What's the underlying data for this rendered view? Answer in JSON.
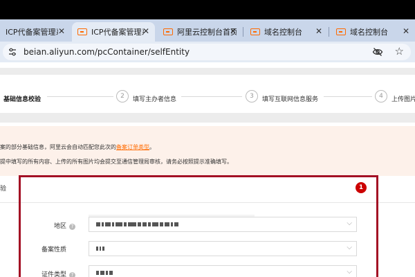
{
  "browser": {
    "tabs": [
      {
        "label": "ICP代备案管理系统",
        "active": false
      },
      {
        "label": "ICP代备案管理系统",
        "active": true
      },
      {
        "label": "阿里云控制台首页",
        "active": false
      },
      {
        "label": "域名控制台",
        "active": false
      },
      {
        "label": "域名控制台",
        "active": false
      }
    ],
    "tab_close": "✕",
    "url": "beian.aliyun.com/pcContainer/selfEntity",
    "star": "☆"
  },
  "steps": [
    {
      "num": "",
      "label": "基础信息校验"
    },
    {
      "num": "2",
      "label": "填写主办者信息"
    },
    {
      "num": "3",
      "label": "填写互联网信息服务"
    },
    {
      "num": "4",
      "label": "上传图片"
    }
  ],
  "notice": {
    "line1_prefix": "案的部分基础信息，阿里云会自动匹配您此次的",
    "line1_link": "备案订单类型",
    "line1_suffix": "。",
    "line2": "提中填写的所有内容、上传的所有图片均会提交至通信管理局审核，请务必按照提示准确填写。"
  },
  "section": {
    "title": "验"
  },
  "annotation_badge": "1",
  "fields": [
    {
      "label": "地区",
      "has_help": true
    },
    {
      "label": "备案性质",
      "has_help": false
    },
    {
      "label": "证件类型",
      "has_help": true
    }
  ],
  "help_glyph": "?",
  "chevron": "⌵",
  "colors": {
    "accent": "#ff6a00",
    "annotation": "#a30f24",
    "badge": "#cc0000"
  }
}
